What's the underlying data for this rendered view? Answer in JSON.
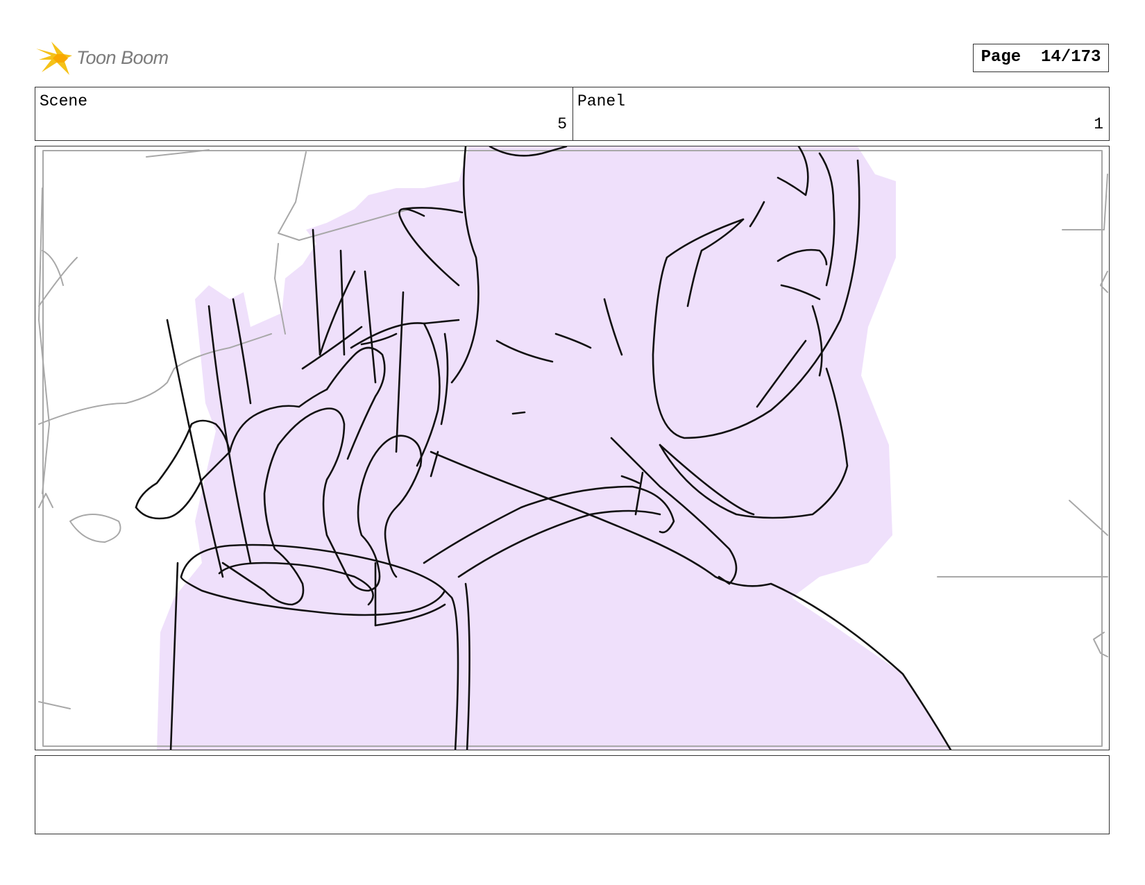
{
  "header": {
    "logo_text": "Toon Boom",
    "page_label": "Page",
    "page_value": "14/173"
  },
  "scene": {
    "label": "Scene",
    "value": "5"
  },
  "panel": {
    "label": "Panel",
    "value": "1"
  },
  "notes": {
    "text": ""
  },
  "colors": {
    "fill": "#efe0fb",
    "line": "#111111",
    "rough": "#a8a8a8",
    "logo_star": "#f5c218",
    "logo_text": "#7b7b7b"
  },
  "icons": {
    "logo": "toon-boom-star-icon"
  }
}
